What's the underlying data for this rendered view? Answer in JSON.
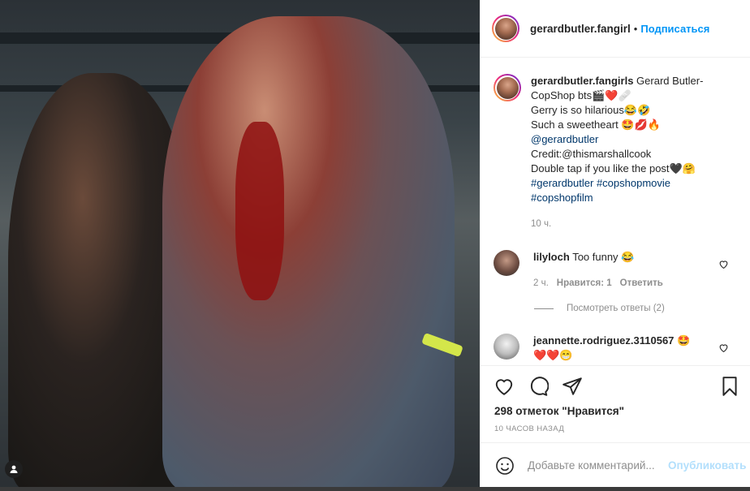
{
  "post": {
    "username": "gerardbutler.fangirls",
    "username_short": "gerardbutler.fangirl",
    "follow_label": "Подписаться",
    "caption_lines": [
      "Gerard Butler-",
      "CopShop bts🎬❤️🩹",
      "Gerry is so hilarious😂🤣",
      "Such a sweetheart 🤩💋🔥",
      "@gerardbutler",
      "Credit:@thismarshallcook",
      "Double tap if you like the post🖤🤗",
      "#gerardbutler #copshopmovie",
      "#copshopfilm"
    ],
    "caption_time": "10 ч.",
    "likes": "298 отметок \"Нравится\"",
    "time_ago": "10 ЧАСОВ НАЗАД"
  },
  "comments": [
    {
      "username": "lilyloch",
      "text": "Too funny 😂",
      "time": "2 ч.",
      "likes": "Нравится: 1",
      "reply": "Ответить",
      "view_replies": "Посмотреть ответы (2)"
    },
    {
      "username": "jeannette.rodriguez.3110567",
      "text_inline": "🤩",
      "text_line2": "❤️❤️😁"
    }
  ],
  "add_comment": {
    "placeholder": "Добавьте комментарий...",
    "publish_label": "Опубликовать"
  },
  "colors": {
    "link": "#00376b",
    "follow": "#0095f6",
    "publish_disabled": "#b2dffc",
    "muted": "#8e8e8e"
  }
}
